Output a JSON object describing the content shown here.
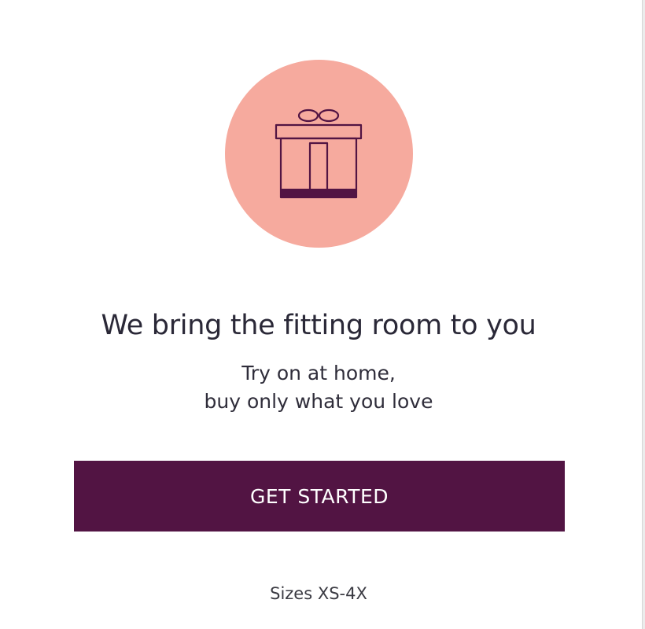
{
  "hero": {
    "icon": "gift-icon",
    "circle_color": "#f6aa9e",
    "icon_color": "#521443"
  },
  "headline": "We bring the fitting room to you",
  "subline": {
    "line1": "Try on at home,",
    "line2": "buy only what you love"
  },
  "cta": {
    "label": "GET STARTED",
    "background": "#521443"
  },
  "sizes_text": "Sizes XS-4X"
}
